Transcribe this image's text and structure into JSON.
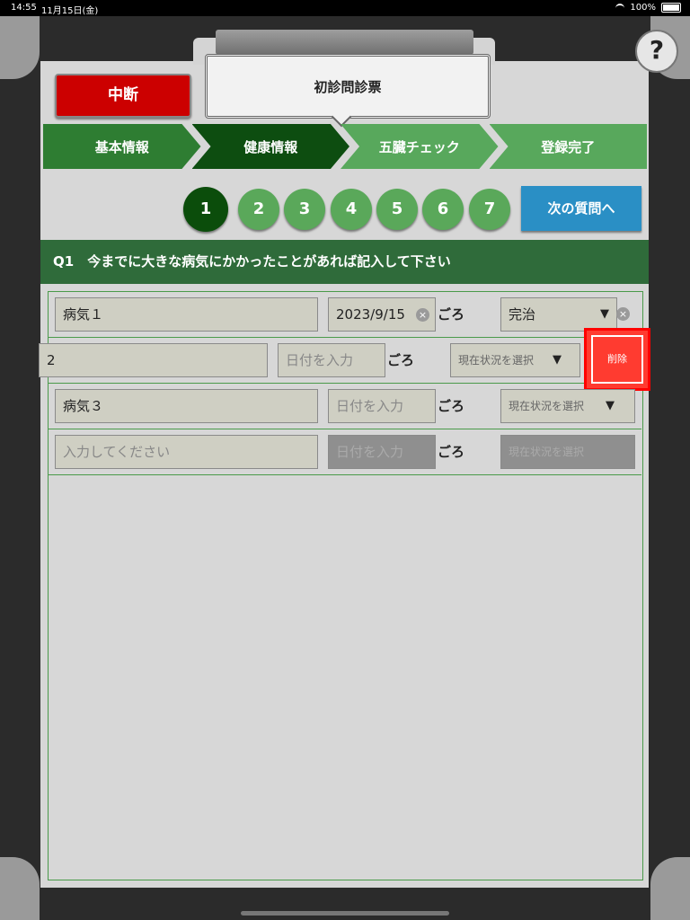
{
  "status_bar": {
    "time": "14:55",
    "date": "11月15日(金)",
    "battery": "100%"
  },
  "app": {
    "title": "初診問診票",
    "pause_label": "中断",
    "help_label": "?",
    "next_label": "次の質問へ"
  },
  "steps": [
    {
      "label": "基本情報"
    },
    {
      "label": "健康情報"
    },
    {
      "label": "五臓チェック"
    },
    {
      "label": "登録完了"
    }
  ],
  "questions": [
    "1",
    "2",
    "3",
    "4",
    "5",
    "6",
    "7"
  ],
  "current_question": "1",
  "question_text": "Q1　今までに大きな病気にかかったことがあれば記入して下さい",
  "rows": [
    {
      "disease": "病気１",
      "date": "2023/9/15",
      "goro": "ごろ",
      "status": "完治"
    },
    {
      "disease": "2",
      "date_placeholder": "日付を入力",
      "goro": "ごろ",
      "status_placeholder": "現在状況を選択",
      "delete_label": "削除"
    },
    {
      "disease": "病気３",
      "date_placeholder": "日付を入力",
      "goro": "ごろ",
      "status_placeholder": "現在状況を選択"
    },
    {
      "disease_placeholder": "入力してください",
      "date_placeholder": "日付を入力",
      "goro": "ごろ",
      "status_placeholder": "現在状況を選択"
    }
  ],
  "icons": {
    "arrow": "▼",
    "clear": "×"
  },
  "colors": {
    "pause": "#cc0000",
    "next": "#2a8fc5",
    "active_step": "#0d4d10",
    "delete": "#ff3b30"
  }
}
